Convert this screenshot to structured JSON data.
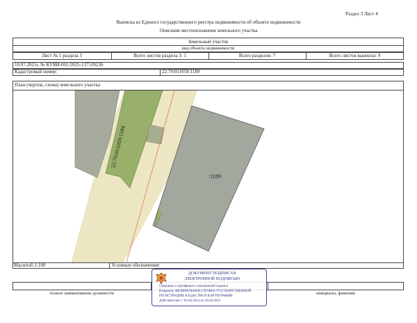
{
  "header": {
    "section_sheet": "Раздел 3   Лист 4",
    "main_title": "Выписка из Единого государственного реестра недвижимости об объекте недвижимости",
    "sub_title": "Описание местоположения земельного участка"
  },
  "object": {
    "type": "Земельный участок",
    "type_caption": "вид объекта недвижимости"
  },
  "sheet_info": {
    "sheet_label": "Лист № 1 раздела 3",
    "total_sheets_section": "Всего листов раздела 3: 1",
    "total_sections": "Всего разделов: 7",
    "total_sheets": "Всего листов выписки: 9"
  },
  "record": {
    "date_number": "10.07.2025г. № КУВИ-001/2025-137539236",
    "cadastral_label": "Кадастровый номер:",
    "cadastral_value": "22:70:011059:1189"
  },
  "plan": {
    "title": "План (чертеж, схема) земельного участка",
    "label_1184": "22:70:011059:1184",
    "label_1189": ":1189",
    "colors": {
      "parcel_fill": "#a3a89f",
      "green_fill": "#98b06a",
      "road_fill": "#ece6c2",
      "gray_fill": "#a6ab9d",
      "red_line": "#e0605c"
    }
  },
  "footer": {
    "scale": "Масштаб 1:100",
    "legend": "Условные обозначения:",
    "position_caption": "полное наименование должности",
    "initials_caption": "инициалы, фамилия"
  },
  "stamp": {
    "title_line1": "ДОКУМЕНТ ПОДПИСАН",
    "title_line2": "ЭЛЕКТРОННОЙ ПОДПИСЬЮ",
    "line1": "Сведения о сертификате электронной подписи",
    "line2": "Владелец: ФЕДЕРАЛЬНАЯ СЛУЖБА ГОСУДАРСТВЕННОЙ",
    "line3": "РЕГИСТРАЦИИ, КАДАСТРА И КАРТОГРАФИИ",
    "line4": "Действителен: с 02.04.2024 по 26.04.2025"
  }
}
